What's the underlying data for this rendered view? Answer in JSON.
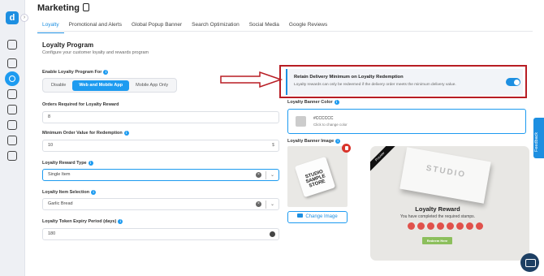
{
  "app": {
    "logo_letter": "d",
    "collapse_glyph": "›"
  },
  "header": {
    "title": "Marketing"
  },
  "tabs": [
    {
      "label": "Loyalty"
    },
    {
      "label": "Promotional and Alerts"
    },
    {
      "label": "Global Popup Banner"
    },
    {
      "label": "Search Optimization"
    },
    {
      "label": "Social Media"
    },
    {
      "label": "Google Reviews"
    }
  ],
  "section": {
    "title": "Loyalty Program",
    "subtitle": "Configure your customer loyalty and rewards program"
  },
  "enable": {
    "label": "Enable Loyalty Program For",
    "options": [
      "Disable",
      "Web and Mobile App",
      "Mobile App Only"
    ],
    "selected": "Web and Mobile App"
  },
  "orders": {
    "label": "Orders Required for Loyalty Reward",
    "value": "8"
  },
  "min_order": {
    "label": "Minimum Order Value for Redemption",
    "value": "10",
    "suffix": "$"
  },
  "reward_type": {
    "label": "Loyalty Reward Type",
    "value": "Single Item"
  },
  "item_selection": {
    "label": "Loyalty Item Selection",
    "value": "Garlic Bread"
  },
  "expiry": {
    "label": "Loyalty Token Expiry Period (days)",
    "value": "180"
  },
  "retain": {
    "title": "Retain Delivery Minimum on Loyalty Redemption",
    "description": "Loyalty rewards can only be redeemed if the delivery order meets the minimum delivery value.",
    "enabled": true
  },
  "banner_color": {
    "label": "Loyalty Banner Color",
    "value": "#CCCCCC",
    "hint": "Click to change color"
  },
  "banner_image": {
    "label": "Loyalty Banner Image",
    "card_text": "STUDIO SAMPLE STORE",
    "change_label": "Change Image"
  },
  "preview": {
    "ribbon": "Preview",
    "card_text": "STUDIO",
    "title": "Loyalty Reward",
    "subtitle": "You have completed the required stamps.",
    "stamp_count": 8,
    "redeem_label": "Redeem Here"
  },
  "feedback": {
    "label": "Feedback"
  },
  "colors": {
    "accent": "#1d8fe1",
    "highlight": "#b81d24",
    "stamp": "#e0524c",
    "redeem": "#8cbf5c"
  }
}
